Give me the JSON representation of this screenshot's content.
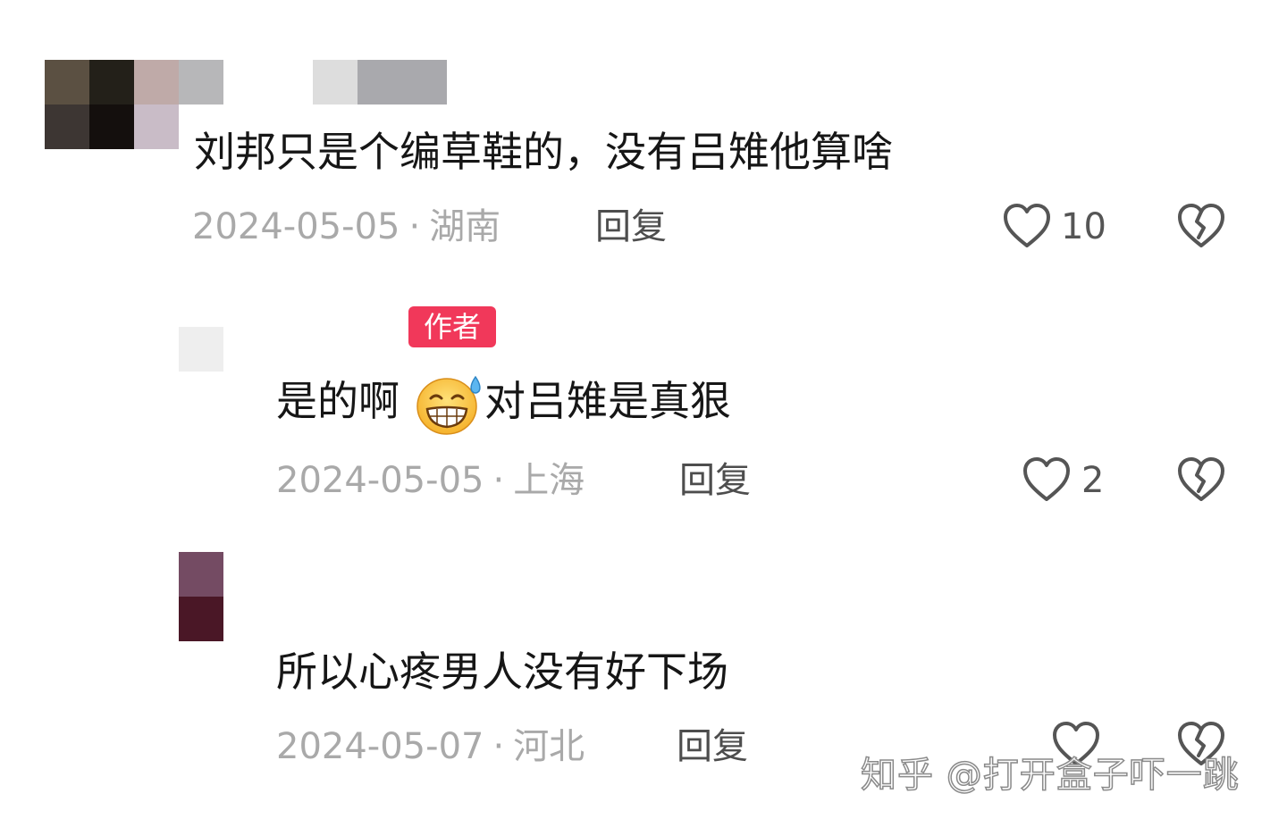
{
  "comments": [
    {
      "text": "刘邦只是个编草鞋的，没有吕雉他算啥",
      "date": "2024-05-05",
      "sep": "·",
      "location": "湖南",
      "reply_label": "回复",
      "likes": "10",
      "avatar_colors": [
        "#5b5042",
        "#232019",
        "#bfaaa8",
        "#b7b7b9",
        "#3d3633",
        "#140f0d",
        "#c9bcc7"
      ],
      "name_pixel_colors": [
        "#dddddd",
        "#a9a9ad",
        "#a9a9ad"
      ]
    },
    {
      "badge": "作者",
      "text_before": "是的啊",
      "text_after": "对吕雉是真狠",
      "date": "2024-05-05",
      "sep": "·",
      "location": "上海",
      "reply_label": "回复",
      "likes": "2",
      "avatar_colors": [
        "#eeeeee"
      ]
    },
    {
      "text": "所以心疼男人没有好下场",
      "date": "2024-05-07",
      "sep": "·",
      "location": "河北",
      "reply_label": "回复",
      "likes": "",
      "avatar_colors": [
        "#744b63",
        "#4a1726"
      ]
    }
  ],
  "watermark": "知乎 @打开盒子吓一跳",
  "colors": {
    "badge": "#f1385a",
    "meta": "#a9a9a9",
    "icon": "#555555"
  },
  "icons": {
    "like": "heart-outline-icon",
    "dislike": "broken-heart-icon",
    "emoji": "grinning-sweat-emoji"
  }
}
